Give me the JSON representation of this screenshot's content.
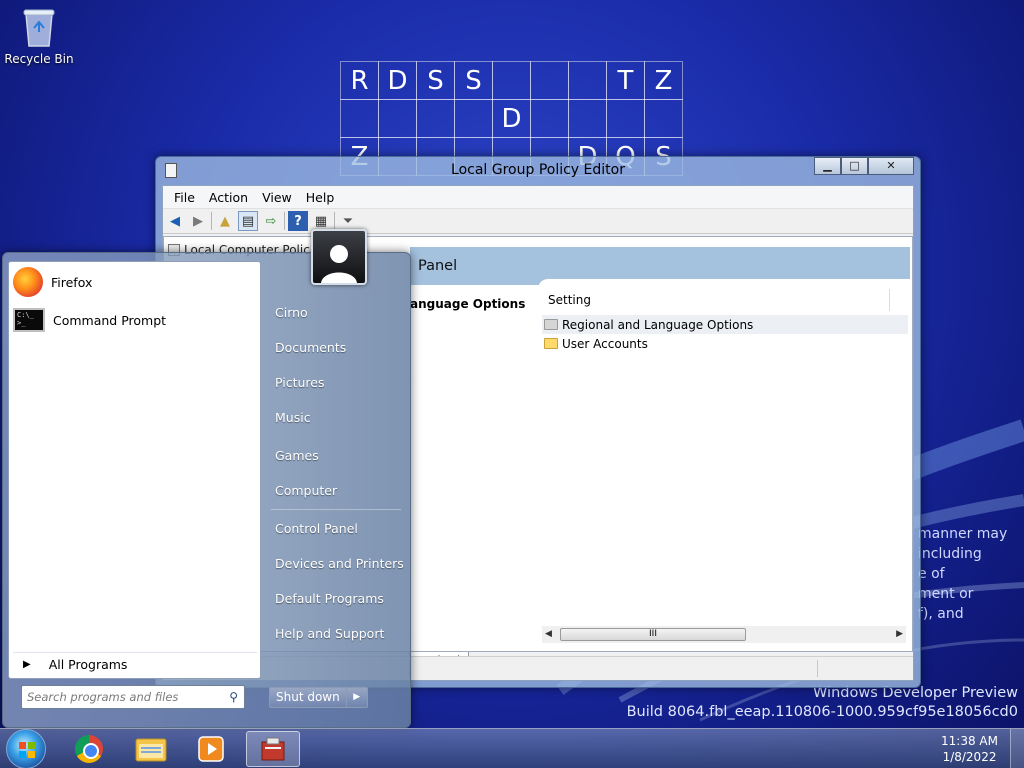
{
  "desktop": {
    "recycle_bin_label": "Recycle Bin",
    "puzzle_rows": [
      [
        "R",
        "D",
        "S",
        "S",
        "",
        "",
        "",
        "T",
        "Z"
      ],
      [
        "",
        "",
        "",
        "",
        "D",
        "",
        "",
        "",
        ""
      ],
      [
        "Z",
        "",
        "",
        "",
        "",
        "",
        "D",
        "Q",
        "S"
      ]
    ],
    "eula_lines": [
      "manner may",
      "including",
      "e of",
      "ment or",
      "f), and"
    ],
    "watermark_line1": "Windows Developer Preview",
    "watermark_line2": "Build 8064.fbl_eeap.110806-1000.959cf95e18056cd0"
  },
  "gpo_window": {
    "title": "Local Group Policy Editor",
    "menu": [
      "File",
      "Action",
      "View",
      "Help"
    ],
    "breadcrumb": "Local Computer Polic",
    "header": "Panel",
    "left_title": "anguage Options",
    "column_header": "Setting",
    "rows": [
      {
        "label": "Regional and Language Options",
        "icon": "folder-gray-icon",
        "selected": true
      },
      {
        "label": "User Accounts",
        "icon": "folder-icon",
        "selected": false
      }
    ],
    "tab_label": "andard",
    "scroll_grip": "III"
  },
  "start_menu": {
    "pinned": [
      {
        "label": "Firefox",
        "icon": "firefox-icon"
      },
      {
        "label": "Command Prompt",
        "icon": "command-prompt-icon"
      }
    ],
    "all_programs": "All Programs",
    "search_placeholder": "Search programs and files",
    "right_items": [
      {
        "label": "Cirno",
        "name": "start-link-cirno"
      },
      {
        "label": "Documents",
        "name": "start-link-documents"
      },
      {
        "label": "Pictures",
        "name": "start-link-pictures"
      },
      {
        "label": "Music",
        "name": "start-link-music"
      },
      {
        "label": "Games",
        "name": "start-link-games"
      },
      {
        "label": "Computer",
        "name": "start-link-computer"
      },
      {
        "label": "Control Panel",
        "name": "start-link-control-panel"
      },
      {
        "label": "Devices and Printers",
        "name": "start-link-devices-printers"
      },
      {
        "label": "Default Programs",
        "name": "start-link-default-programs"
      },
      {
        "label": "Help and Support",
        "name": "start-link-help-support"
      }
    ],
    "shutdown_label": "Shut down"
  },
  "taskbar": {
    "time": "11:38 AM",
    "date": "1/8/2022",
    "items": [
      "chrome-icon",
      "file-explorer-icon",
      "media-player-icon",
      "policy-editor-icon"
    ]
  },
  "colors": {
    "desktop_blue": "#1a2ba8",
    "header_blue": "#a4c1de"
  }
}
